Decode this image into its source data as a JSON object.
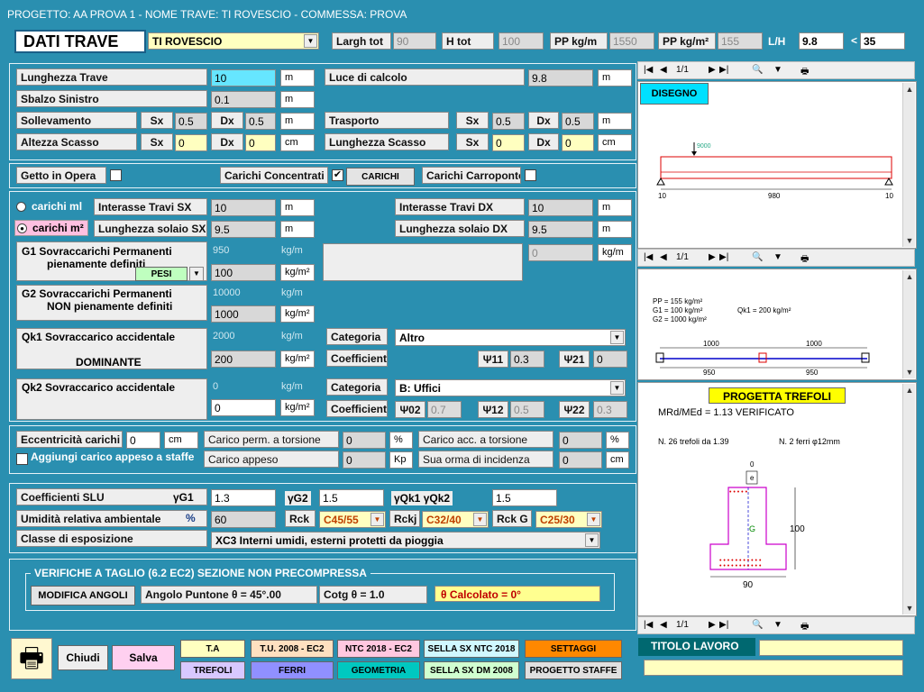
{
  "window": {
    "title": "PROGETTO: AA PROVA 1 - NOME TRAVE: TI ROVESCIO - COMMESSA: PROVA"
  },
  "header": {
    "section_title": "DATI TRAVE",
    "beam_type": "TI ROVESCIO",
    "largh_tot_label": "Largh tot",
    "largh_tot": "90",
    "h_tot_label": "H tot",
    "h_tot": "100",
    "pp_kgm_label": "PP kg/m",
    "pp_kgm": "1550",
    "pp_kgm2_label": "PP kg/m²",
    "pp_kgm2": "155",
    "lh_label": "L/H",
    "lh": "9.8",
    "lh_cmp": "<",
    "lh_max": "35"
  },
  "geom": {
    "lunghezza_label": "Lunghezza Trave",
    "lunghezza": "10",
    "luce_label": "Luce di calcolo",
    "luce": "9.8",
    "sbalzo_label": "Sbalzo Sinistro",
    "sbalzo": "0.1",
    "soll_label": "Sollevamento",
    "trasp_label": "Trasporto",
    "sx": "Sx",
    "dx": "Dx",
    "soll_sx": "0.5",
    "soll_dx": "0.5",
    "trasp_sx": "0.5",
    "trasp_dx": "0.5",
    "altezza_label": "Altezza Scasso",
    "alt_sx": "0",
    "alt_dx": "0",
    "lung_scasso_label": "Lunghezza Scasso",
    "ls_sx": "0",
    "ls_dx": "0",
    "m": "m",
    "cm": "cm"
  },
  "options": {
    "getto_label": "Getto in Opera",
    "carichi_conc_label": "Carichi Concentrati",
    "carichi_conc_check": "✔",
    "carichi_btn": "CARICHI",
    "carroponte_label": "Carichi Carroponte"
  },
  "loads": {
    "radio_ml": "carichi ml",
    "radio_m2": "carichi m²",
    "int_sx_label": "Interasse Travi SX",
    "int_sx": "10",
    "int_dx_label": "Interasse Travi DX",
    "int_dx": "10",
    "solaio_sx_label": "Lunghezza solaio SX",
    "solaio_sx": "9.5",
    "solaio_dx_label": "Lunghezza solaio DX",
    "solaio_dx": "9.5",
    "g1_label": "G1   Sovraccarichi Permanenti",
    "g1_label2": "pienamente definiti",
    "pesi_btn": "PESI",
    "g1_ml": "950",
    "g1_val": "100",
    "g1_extra": "0",
    "g2_label": "G2   Sovraccarichi Permanenti",
    "g2_label2": "NON pienamente definiti",
    "g2_ml": "10000",
    "g2_val": "1000",
    "qk1_label": "Qk1  Sovraccarico accidentale",
    "qk1_label2": "DOMINANTE",
    "qk1_ml": "2000",
    "qk1_val": "200",
    "qk2_label": "Qk2  Sovraccarico accidentale",
    "qk2_ml": "0",
    "qk2_val": "0",
    "categoria": "Categoria",
    "coefficienti": "Coefficienti",
    "cat1": "Altro",
    "cat2": "B: Uffici",
    "psi11_label": "Ψ11",
    "psi11": "0.3",
    "psi21_label": "Ψ21",
    "psi21": "0",
    "psi02_label": "Ψ02",
    "psi02": "0.7",
    "psi12_label": "Ψ12",
    "psi12": "0.5",
    "psi22_label": "Ψ22",
    "psi22": "0.3",
    "kgm": "kg/m",
    "kgm2": "kg/m²"
  },
  "ecc": {
    "ecc_label": "Eccentricità carichi",
    "ecc": "0",
    "cm": "cm",
    "tors_perm_label": "Carico perm. a torsione",
    "tors_perm": "0",
    "pct": "%",
    "tors_acc_label": "Carico acc. a torsione",
    "tors_acc": "0",
    "aggiungi_label": "Aggiungi carico appeso a staffe",
    "appeso_label": "Carico appeso",
    "appeso": "0",
    "kp": "Kp",
    "orma_label": "Sua orma di incidenza",
    "orma": "0"
  },
  "slu": {
    "coeff_label": "Coefficienti SLU",
    "g1_sym": "γG1",
    "g1": "1.3",
    "g2_sym": "γG2",
    "g2": "1.5",
    "qk_sym": "γQk1  γQk2",
    "qk": "1.5",
    "umid_label": "Umidità relativa ambientale",
    "umid_pct": "%",
    "umid": "60",
    "rck_label": "Rck",
    "rck": "C45/55",
    "rckj_label": "Rckj",
    "rckj": "C32/40",
    "rckg_label": "Rck G",
    "rckg": "C25/30",
    "classe_label": "Classe di esposizione",
    "classe": "XC3   Interni umidi, esterni protetti da pioggia"
  },
  "shear": {
    "title": "VERIFICHE A TAGLIO (6.2 EC2) SEZIONE NON PRECOMPRESSA",
    "mod_btn": "MODIFICA ANGOLI",
    "angolo": "Angolo Puntone  θ  =  45°.00",
    "cotg": "Cotg θ = 1.0",
    "calcolato": "θ  Calcolato =  0°"
  },
  "right": {
    "page": "1/1",
    "disegno_btn": "DISEGNO",
    "load_label": "9000",
    "dim_left": "10",
    "dim_mid": "980",
    "dim_right": "10",
    "pp": "PP = 155 kg/m²",
    "g1": "G1 = 100 kg/m²",
    "g2": "G2 = 1000 kg/m²",
    "qk1": "Qk1 = 200 kg/m²",
    "int1": "1000",
    "int2": "1000",
    "sol1": "950",
    "sol2": "950",
    "progetta_btn": "PROGETTA TREFOLI",
    "verifica": "MRd/MEd = 1.13 VERIFICATO",
    "trefoli": "N. 26 trefoli da 1.39",
    "ferri": "N. 2 ferri φ12mm",
    "sec_top": "0",
    "sec_e": "e",
    "sec_h": "100",
    "sec_b": "90",
    "sec_g": "G"
  },
  "footer": {
    "chiudi": "Chiudi",
    "salva": "Salva",
    "ta": "T.A",
    "tu2008": "T.U. 2008 - EC2",
    "ntc2018": "NTC 2018 - EC2",
    "sella_ntc": "SELLA SX NTC 2018",
    "settaggi": "SETTAGGI",
    "trefoli": "TREFOLI",
    "ferri": "FERRI",
    "geometria": "GEOMETRIA",
    "sella_dm": "SELLA SX DM 2008",
    "progetto_staffe": "PROGETTO STAFFE",
    "titolo_lavoro": "TITOLO LAVORO"
  },
  "colors": {
    "bg": "#2a8fb0",
    "section": "#e0e0e0"
  },
  "chart_data": {
    "type": "diagram",
    "beam_length": "980",
    "load": "9000",
    "section": {
      "b": "90",
      "h": "100"
    }
  }
}
